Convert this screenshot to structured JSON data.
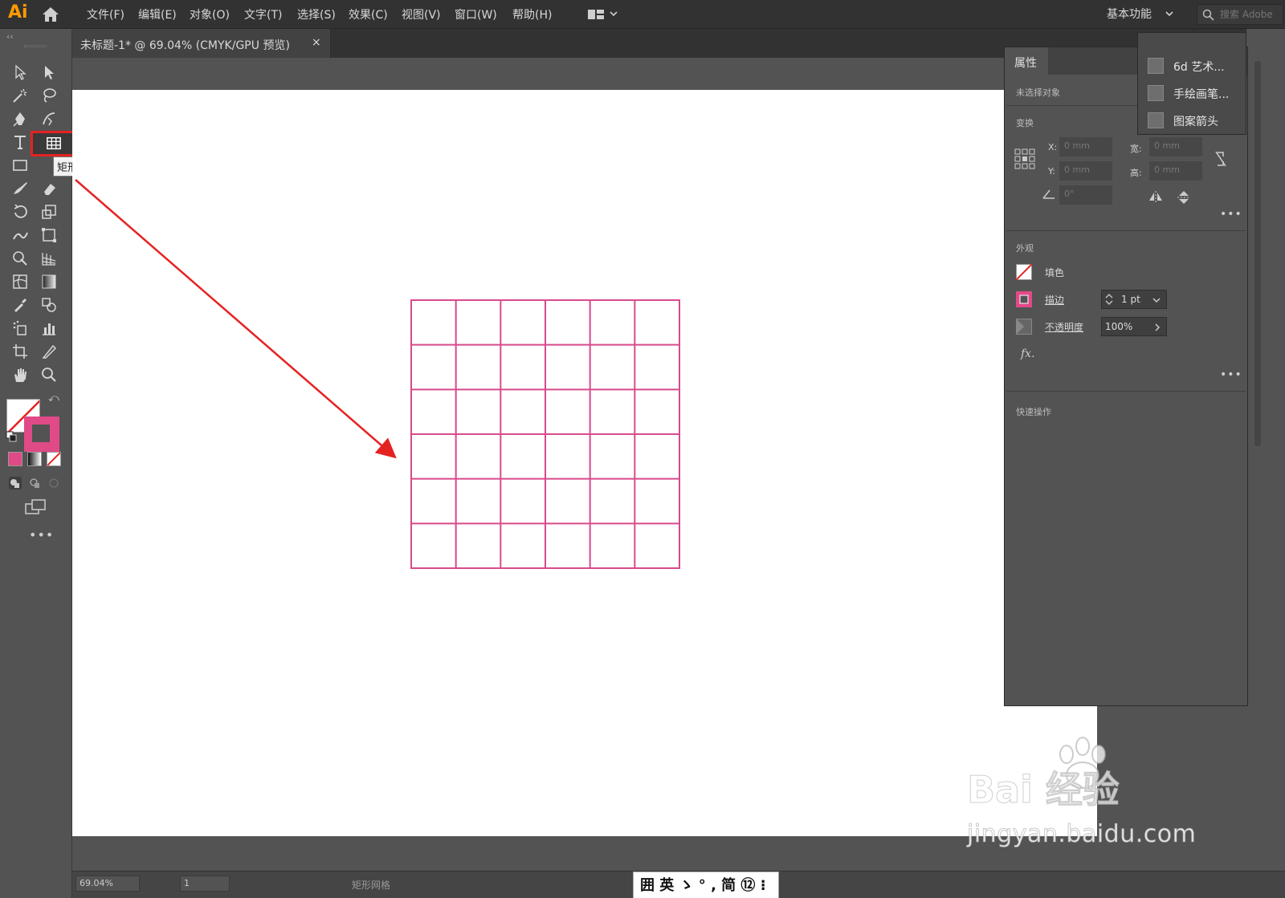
{
  "app": {
    "logo_text": "Ai",
    "menu": [
      "文件(F)",
      "编辑(E)",
      "对象(O)",
      "文字(T)",
      "选择(S)",
      "效果(C)",
      "视图(V)",
      "窗口(W)",
      "帮助(H)"
    ],
    "workspace": "基本功能",
    "search_placeholder": "搜索 Adobe"
  },
  "document": {
    "tab_title": "未标题-1* @ 69.04% (CMYK/GPU 预览)",
    "tab_close": "×",
    "grid": {
      "rows": 6,
      "columns": 6,
      "stroke_color": "#d94a8c"
    }
  },
  "toolbar": {
    "collapse": "‹‹",
    "tooltip": "矩形网格工具",
    "more": "•••"
  },
  "properties": {
    "tab": "属性",
    "selection_status": "未选择对象",
    "transform_title": "变换",
    "x_label": "X:",
    "x_value": "0 mm",
    "y_label": "Y:",
    "y_value": "0 mm",
    "width_label": "宽:",
    "width_value": "0 mm",
    "height_label": "高:",
    "height_value": "0 mm",
    "angle_value": "0°",
    "appearance_title": "外观",
    "fill_label": "填色",
    "stroke_label": "描边",
    "stroke_weight": "1 pt",
    "opacity_label": "不透明度",
    "opacity_value": "100%",
    "fx_label": "fx.",
    "quick_actions_title": "快速操作",
    "more": "•••"
  },
  "libraries": {
    "collapse": "››",
    "close": "×",
    "items": [
      "6d 艺术...",
      "手绘画笔...",
      "图案箭头"
    ]
  },
  "statusbar": {
    "zoom": "69.04%",
    "artboard": "1",
    "current_tool": "矩形网格",
    "ime": "囲 英 ゝ ° , 简 ⑫ ⁝"
  },
  "watermark": {
    "brand": "Bai 经验",
    "url": "jingyan.baidu.com"
  },
  "colors": {
    "accent": "#e52222",
    "stroke_pink": "#e04a87",
    "panel_bg": "#535353",
    "chrome_bg": "#323232"
  }
}
